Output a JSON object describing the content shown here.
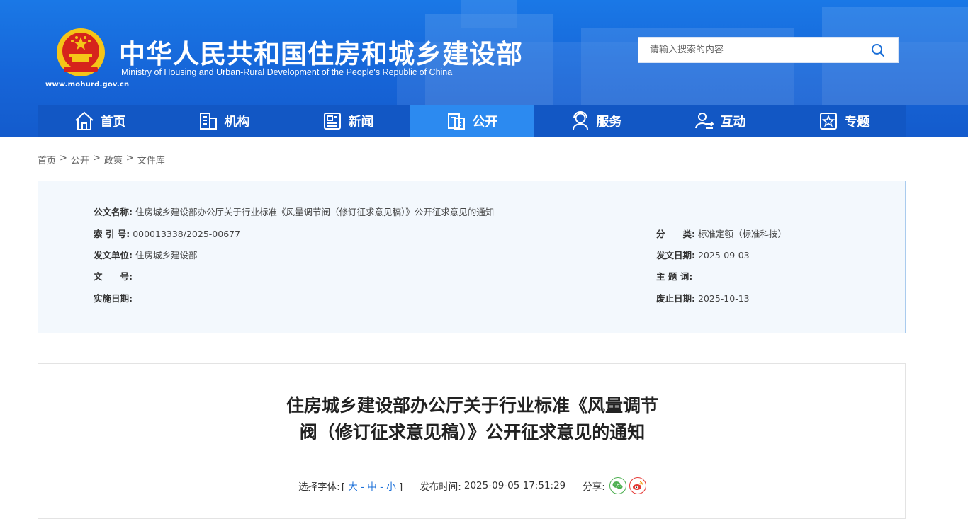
{
  "header": {
    "title": "中华人民共和国住房和城乡建设部",
    "subtitle": "Ministry of Housing and Urban-Rural Development of the People's Republic of China",
    "url": "www.mohurd.gov.cn",
    "emblem_icon": "national-emblem-icon"
  },
  "search": {
    "placeholder": "请输入搜索的内容",
    "icon": "search-icon"
  },
  "nav": {
    "items": [
      {
        "label": "首页",
        "icon": "home-icon"
      },
      {
        "label": "机构",
        "icon": "building-icon"
      },
      {
        "label": "新闻",
        "icon": "news-icon"
      },
      {
        "label": "公开",
        "icon": "disclosure-icon"
      },
      {
        "label": "服务",
        "icon": "service-icon"
      },
      {
        "label": "互动",
        "icon": "interaction-icon"
      },
      {
        "label": "专题",
        "icon": "topic-icon"
      }
    ],
    "active_index": 3
  },
  "breadcrumb": {
    "items": [
      "首页",
      "公开",
      "政策",
      "文件库"
    ],
    "separator": ">"
  },
  "info": {
    "doc_name_label": "公文名称:",
    "doc_name": "住房城乡建设部办公厅关于行业标准《风量调节阀（修订征求意见稿）》公开征求意见的通知",
    "index_label": "索 引 号:",
    "index": "000013338/2025-00677",
    "category_label": "分　　类:",
    "category": "标准定额（标准科技）",
    "issuer_label": "发文单位:",
    "issuer": "住房城乡建设部",
    "issue_date_label": "发文日期:",
    "issue_date": "2025-09-03",
    "doc_no_label": "文　　号:",
    "doc_no": "",
    "keywords_label": "主 题 词:",
    "keywords": "",
    "effective_label": "实施日期:",
    "effective": "",
    "expire_label": "废止日期:",
    "expire": "2025-10-13"
  },
  "article": {
    "title_line1": "住房城乡建设部办公厅关于行业标准《风量调节",
    "title_line2": "阀（修订征求意见稿）》公开征求意见的通知",
    "font_label": "选择字体:",
    "bracket_open": "[",
    "font_large": "大",
    "font_dash1": " - ",
    "font_medium": "中",
    "font_dash2": " - ",
    "font_small": "小",
    "bracket_close": "]",
    "publish_label": "发布时间:",
    "publish_time": "2025-09-05 17:51:29",
    "share_label": "分享:",
    "share_icons": [
      "wechat-icon",
      "weibo-icon"
    ]
  },
  "colors": {
    "header_blue": "#1665d8",
    "nav_blue": "#1257c4",
    "nav_active": "#2c8af0",
    "info_bg": "#f3f8fd",
    "info_border": "#a9cbee",
    "link_blue": "#1a6fd8"
  }
}
